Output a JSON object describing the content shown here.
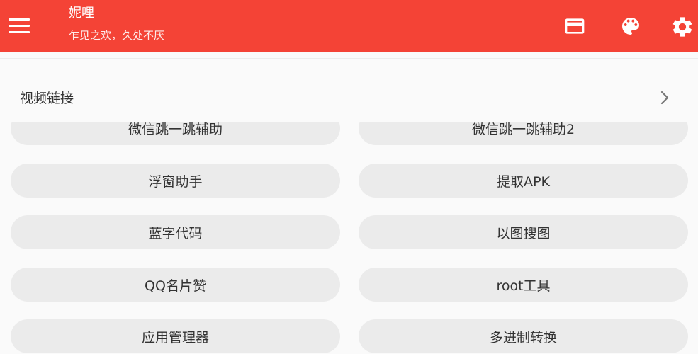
{
  "appbar": {
    "title": "妮哩",
    "subtitle": "乍见之欢，久处不厌",
    "actions": [
      {
        "icon": "card-icon"
      },
      {
        "icon": "palette-icon"
      },
      {
        "icon": "gear-icon"
      }
    ]
  },
  "list": {
    "item_label": "视频链接",
    "chevron_icon": "chevron-right-icon"
  },
  "buttons": {
    "wechat_jump": "微信跳一跳辅助",
    "wechat_jump2": "微信跳一跳辅助2",
    "float_window": "浮窗助手",
    "extract_apk": "提取APK",
    "blue_text": "蓝字代码",
    "image_search": "以图搜图",
    "qq_likes": "QQ名片赞",
    "root_tools": "root工具",
    "app_manager": "应用管理器",
    "base_convert": "多进制转换"
  },
  "colors": {
    "primary": "#f44336",
    "button_bg": "#ebebeb",
    "background": "#fafafa"
  }
}
